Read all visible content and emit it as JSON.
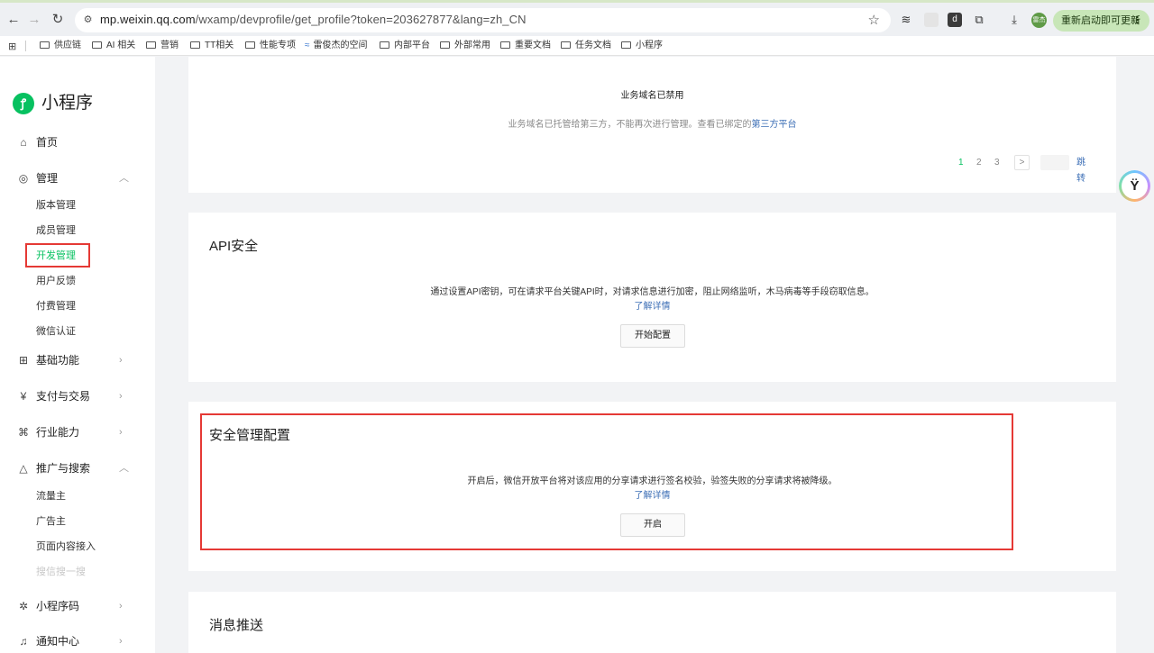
{
  "browser": {
    "url_host": "mp.weixin.qq.com",
    "url_path": "/wxamp/devprofile/get_profile?token=203627877&lang=zh_CN",
    "profile_label": "雷杰",
    "update_label": "重新启动即可更新",
    "bookmarks": [
      "供应链",
      "AI 相关",
      "营销",
      "TT相关",
      "性能专项",
      "雷俊杰的空间",
      "内部平台",
      "外部常用",
      "重要文档",
      "任务文档",
      "小程序"
    ]
  },
  "sidebar": {
    "logo_text": "小程序",
    "home": "首页",
    "manage": "管理",
    "manage_items": [
      "版本管理",
      "成员管理",
      "开发管理",
      "用户反馈",
      "付费管理",
      "微信认证"
    ],
    "basic": "基础功能",
    "payment": "支付与交易",
    "industry": "行业能力",
    "promotion": "推广与搜索",
    "promotion_items": [
      "流量主",
      "广告主",
      "页面内容接入",
      "搜信搜一搜"
    ],
    "qrcode": "小程序码",
    "notice": "通知中心"
  },
  "domain_card": {
    "disabled_title": "业务域名已禁用",
    "desc_prefix": "业务域名已托管给第三方，不能再次进行管理。查看已绑定的",
    "desc_link": "第三方平台",
    "pages": [
      "1",
      "2",
      "3"
    ],
    "next": ">",
    "jump": "跳转"
  },
  "api_card": {
    "title": "API安全",
    "desc": "通过设置API密钥，可在请求平台关键API时，对请求信息进行加密，阻止网络监听，木马病毒等手段窃取信息。",
    "link": "了解详情",
    "button": "开始配置"
  },
  "security_card": {
    "title": "安全管理配置",
    "desc": "开启后，微信开放平台将对该应用的分享请求进行签名校验，验签失败的分享请求将被降级。",
    "link": "了解详情",
    "button": "开启"
  },
  "push_card": {
    "title": "消息推送"
  },
  "colors": {
    "accent": "#07c160",
    "link": "#3d6fb6",
    "highlight": "#e53935"
  }
}
